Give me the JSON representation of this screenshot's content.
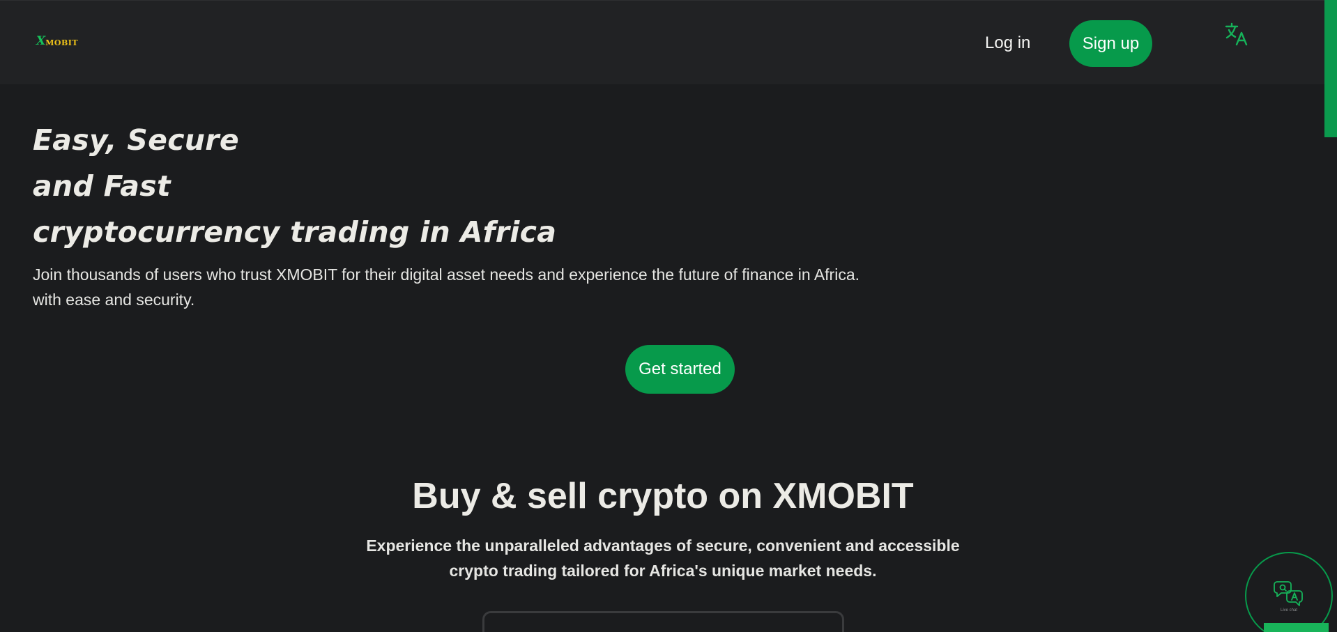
{
  "header": {
    "logo": {
      "mark": "X",
      "text": "MOBIT"
    },
    "login_label": "Log in",
    "signup_label": "Sign up",
    "translate_icon": "translate-icon"
  },
  "hero": {
    "title_lines": [
      "Easy, Secure",
      "and Fast",
      "cryptocurrency trading in Africa"
    ],
    "description_lines": [
      "Join thousands of users who trust XMOBIT for their digital asset needs and experience the future of finance in Africa.",
      "with ease and security."
    ],
    "cta_label": "Get started"
  },
  "buy_sell": {
    "title": "Buy & sell crypto on XMOBIT",
    "description_lines": [
      "Experience the unparalleled advantages of secure, convenient and accessible",
      "crypto trading tailored for Africa's unique market needs."
    ]
  },
  "chat": {
    "icon": "chat-support-icon",
    "caption": "Live chat"
  },
  "colors": {
    "accent": "#079a4b",
    "logo_green": "#16c25a",
    "logo_yellow": "#f0c419",
    "background": "#1b1c1e",
    "header_background": "#212224"
  }
}
